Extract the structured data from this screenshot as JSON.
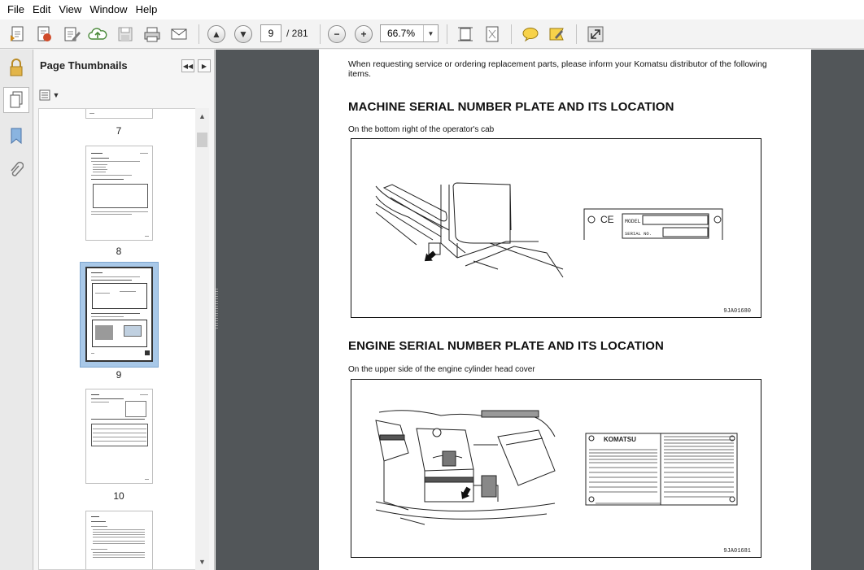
{
  "menu": [
    "File",
    "Edit",
    "View",
    "Window",
    "Help"
  ],
  "toolbar": {
    "page_number": "9",
    "page_total": "/ 281",
    "zoom": "66.7%"
  },
  "panel": {
    "title": "Page Thumbnails"
  },
  "thumbnails": [
    {
      "label": "7"
    },
    {
      "label": "8"
    },
    {
      "label": "9"
    },
    {
      "label": "10"
    }
  ],
  "document": {
    "intro": "When requesting service or ordering replacement parts, please inform your Komatsu distributor of the following items.",
    "section1": {
      "heading": "MACHINE SERIAL NUMBER PLATE AND ITS LOCATION",
      "caption": "On the bottom right of the operator's cab",
      "plate_model": "MODEL",
      "plate_serial": "SERIAL NO.",
      "plate_ce": "CE",
      "figure_code": "9JA01680"
    },
    "section2": {
      "heading": "ENGINE SERIAL NUMBER PLATE AND ITS LOCATION",
      "caption": "On the upper side of the engine cylinder head cover",
      "brand": "KOMATSU",
      "figure_code": "9JA01681"
    }
  },
  "colors": {
    "doc_background": "#525659",
    "selected_thumb": "#a8c8e8"
  }
}
